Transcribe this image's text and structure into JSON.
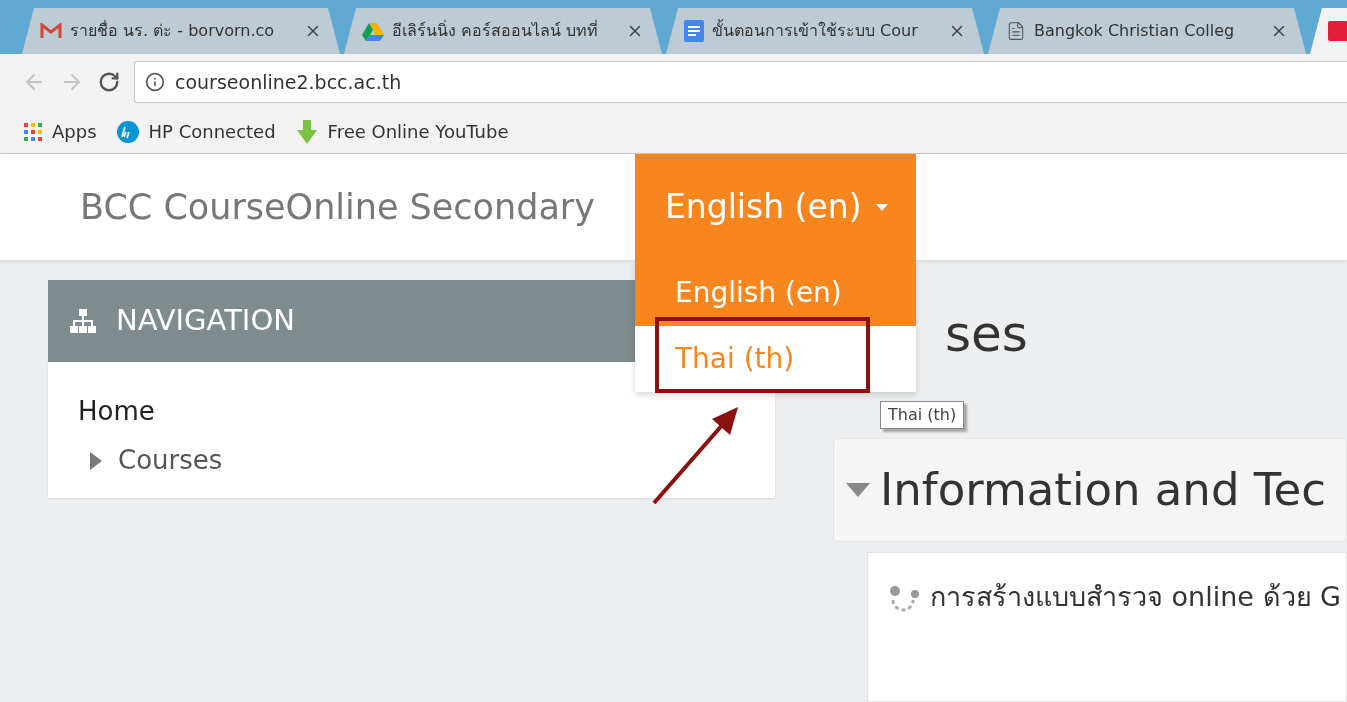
{
  "browser": {
    "tabs": [
      {
        "title": "รายชื่อ นร. ต่ะ - borvorn.co",
        "kind": "mail",
        "selected": false
      },
      {
        "title": "อีเลิร์นนิ่ง คอร์สออนไลน์ บทที่",
        "kind": "drive",
        "selected": false
      },
      {
        "title": "ขั้นตอนการเข้าใช้ระบบ Cour",
        "kind": "doc",
        "selected": false
      },
      {
        "title": "Bangkok Christian Colleg",
        "kind": "page",
        "selected": false
      },
      {
        "kind": "app",
        "selected": true
      }
    ],
    "address": "courseonline2.bcc.ac.th",
    "bookmarks": [
      {
        "label": "Apps",
        "kind": "apps"
      },
      {
        "label": "HP Connected",
        "kind": "hp"
      },
      {
        "label": "Free Online YouTube",
        "kind": "download"
      }
    ]
  },
  "site": {
    "title": "BCC CourseOnline Secondary",
    "language_menu": {
      "current": "English (en)",
      "expanded": true,
      "options": [
        {
          "label": "English (en)",
          "highlighted": false
        },
        {
          "label": "Thai (th)",
          "highlighted": true
        }
      ],
      "tooltip": "Thai (th)"
    }
  },
  "navigation": {
    "title": "NAVIGATION",
    "home": "Home",
    "children": [
      {
        "label": "Courses",
        "expanded": false
      }
    ]
  },
  "main": {
    "heading": "ses",
    "section": {
      "title": "Information and Tec",
      "expanded": true
    },
    "activities": [
      {
        "label": "การสร้างแบบสำรวจ online ด้วย G"
      }
    ]
  }
}
